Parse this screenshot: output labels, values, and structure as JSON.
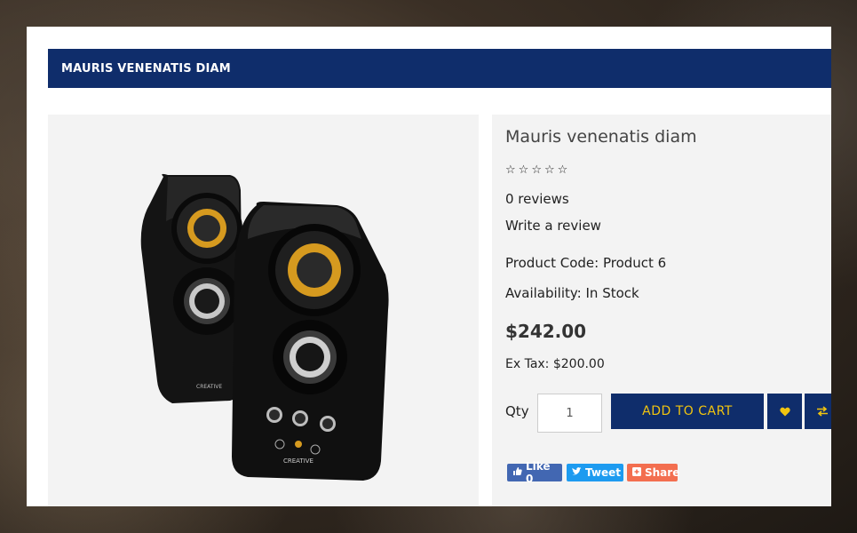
{
  "modal": {
    "title": "MAURIS VENENATIS DIAM"
  },
  "product": {
    "name": "Mauris venenatis diam",
    "rating": 0,
    "rating_max": 5,
    "reviews": "0 reviews",
    "write_review": "Write a review",
    "product_code": "Product Code: Product 6",
    "availability": "Availability: In Stock",
    "price": "$242.00",
    "ex_tax": "Ex Tax: $200.00",
    "image_brand_text": "CREATIVE"
  },
  "purchase": {
    "qty_label": "Qty",
    "qty_value": "1",
    "add_to_cart": "ADD TO CART",
    "wishlist_icon": "heart-icon",
    "compare_icon": "swap-arrows-icon"
  },
  "social": {
    "facebook_label": "Like 0",
    "twitter_label": "Tweet",
    "share_label": "Share"
  },
  "colors": {
    "brand_navy": "#0f2d6b",
    "button_text": "#f1c40f",
    "facebook": "#4267b2",
    "twitter": "#1d9bf0",
    "share": "#f36e4f"
  }
}
